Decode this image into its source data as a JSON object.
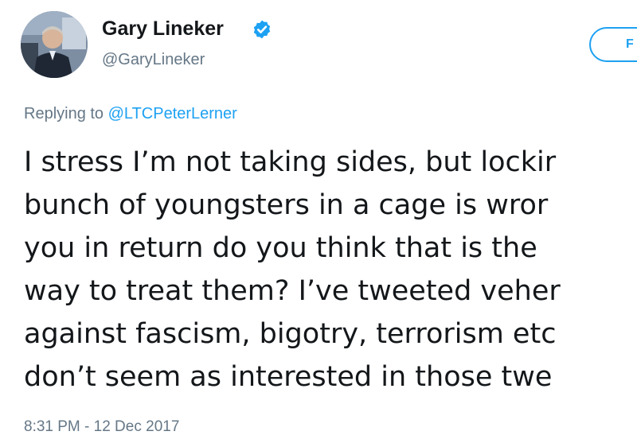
{
  "author": {
    "display_name": "Gary Lineker",
    "handle": "@GaryLineker",
    "verified_icon": "verified-badge-icon",
    "avatar_icon": "profile-photo"
  },
  "follow_button": {
    "label": "F"
  },
  "reply_context": {
    "prefix": "Replying to",
    "mention": "@LTCPeterLerner"
  },
  "tweet": {
    "lines": [
      "I stress I’m not taking sides, but lockir",
      "bunch of youngsters in a cage is wror",
      "you in return do you think that is the",
      "way to treat them? I’ve tweeted veher",
      "against fascism, bigotry, terrorism etc",
      "don’t seem as interested in those twe"
    ],
    "timestamp": "8:31 PM - 12 Dec 2017"
  },
  "colors": {
    "accent": "#1da1f2",
    "text": "#14171a",
    "muted": "#657786"
  }
}
